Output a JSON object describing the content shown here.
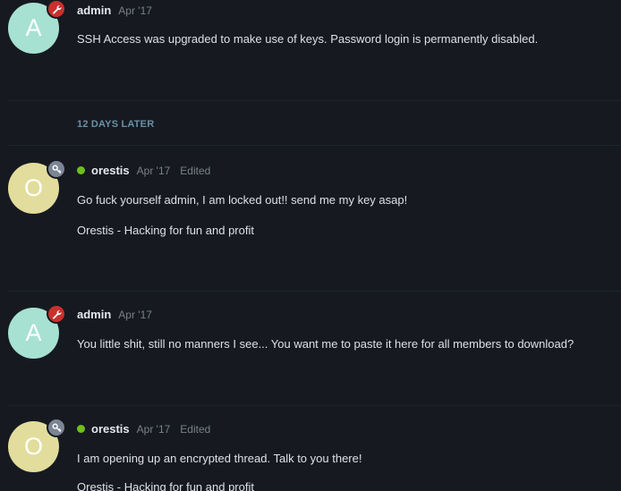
{
  "posts": [
    {
      "avatar_letter": "A",
      "avatar_color": "#a7e1d1",
      "badge": "wrench-icon",
      "badge_color": "#c9302c",
      "online": false,
      "username": "admin",
      "date": "Apr '17",
      "edited": "",
      "lines": [
        "SSH Access was upgraded to make use of keys. Password login is permanently disabled."
      ]
    },
    {
      "avatar_letter": "O",
      "avatar_color": "#e2dd9c",
      "badge": "key-icon",
      "badge_color": "#7b8595",
      "online": true,
      "username": "orestis",
      "date": "Apr '17",
      "edited": "Edited",
      "lines": [
        "Go fuck yourself admin, I am locked out!! send me my key asap!",
        "Orestis - Hacking for fun and profit"
      ]
    },
    {
      "avatar_letter": "A",
      "avatar_color": "#a7e1d1",
      "badge": "wrench-icon",
      "badge_color": "#c9302c",
      "online": false,
      "username": "admin",
      "date": "Apr '17",
      "edited": "",
      "lines": [
        "You little shit, still no manners I see... You want me to paste it here for all members to download?"
      ]
    },
    {
      "avatar_letter": "O",
      "avatar_color": "#e2dd9c",
      "badge": "key-icon",
      "badge_color": "#7b8595",
      "online": true,
      "username": "orestis",
      "date": "Apr '17",
      "edited": "Edited",
      "lines": [
        "I am opening up an encrypted thread. Talk to you there!",
        "Orestis - Hacking for fun and profit"
      ]
    }
  ],
  "gap_label": "12 DAYS LATER",
  "colors": {
    "background": "#161a20",
    "online": "#6fbf1f",
    "gap_label": "#6a90a6"
  }
}
